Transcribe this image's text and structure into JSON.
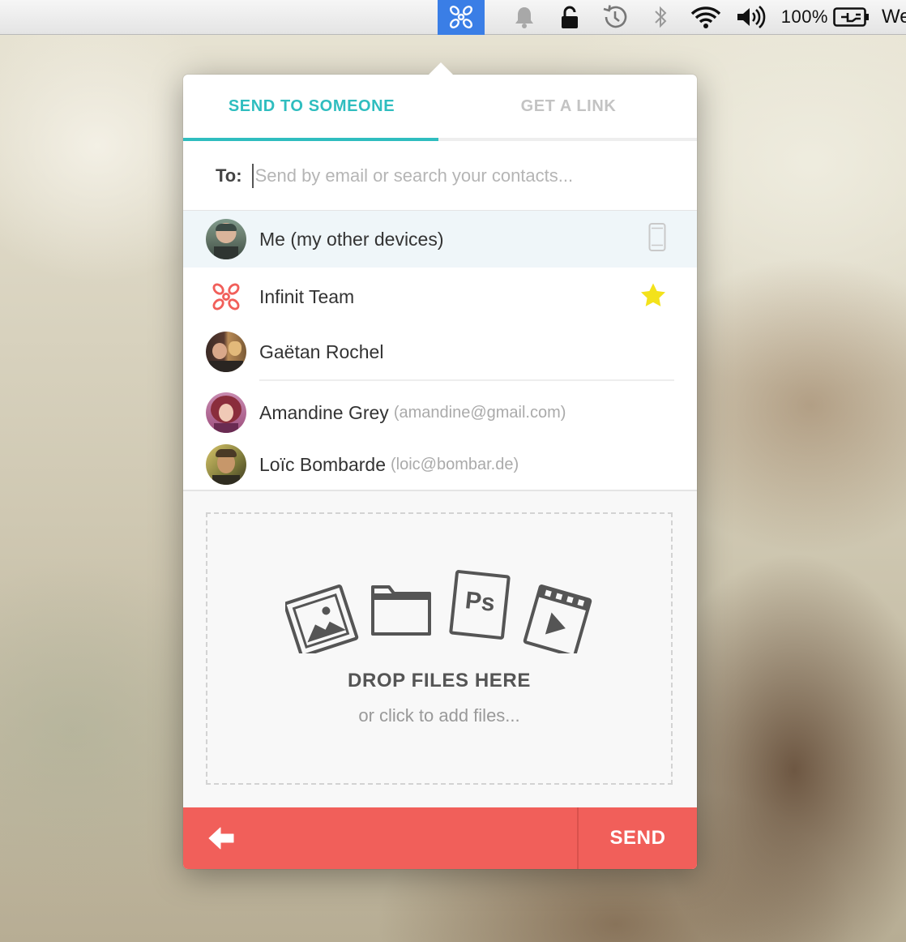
{
  "menubar": {
    "app_icon": "infinit-logo-icon",
    "icons": [
      "bell-icon",
      "lock-icon",
      "time-machine-icon",
      "bluetooth-icon",
      "wifi-icon",
      "volume-icon"
    ],
    "battery_percent": "100%",
    "clock_partial": "We"
  },
  "tabs": [
    {
      "label": "SEND TO SOMEONE",
      "active": true
    },
    {
      "label": "GET A LINK",
      "active": false
    }
  ],
  "recipient": {
    "label": "To:",
    "placeholder": "Send by email or search your contacts...",
    "value": ""
  },
  "contacts": [
    {
      "name": "Me (my other devices)",
      "email": "",
      "badge": "phone-icon",
      "selected": true
    },
    {
      "name": "Infinit Team",
      "email": "",
      "badge": "star-icon",
      "selected": false
    },
    {
      "name": "Gaëtan Rochel",
      "email": "",
      "badge": "",
      "selected": false
    },
    {
      "name": "Amandine Grey",
      "email": "(amandine@gmail.com)",
      "badge": "",
      "selected": false
    },
    {
      "name": "Loïc Bombarde",
      "email": "(loic@bombar.de)",
      "badge": "",
      "selected": false
    }
  ],
  "dropzone": {
    "icons": [
      "image-file-icon",
      "folder-icon",
      "photoshop-file-icon",
      "video-file-icon"
    ],
    "ps_label": "Ps",
    "title": "DROP FILES HERE",
    "subtitle": "or click to add files..."
  },
  "footer": {
    "back_icon": "back-arrow-icon",
    "send_label": "SEND"
  },
  "colors": {
    "accent": "#2fbdbf",
    "footer": "#f15f5a",
    "star": "#f3e21b",
    "logo": "#f15f5a"
  }
}
